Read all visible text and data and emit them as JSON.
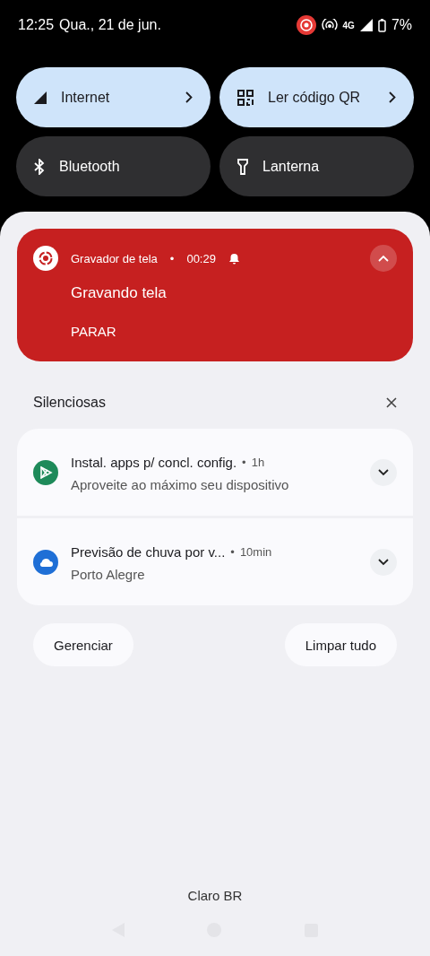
{
  "status_bar": {
    "time": "12:25",
    "date": "Qua., 21 de jun.",
    "network": "4G",
    "battery": "7%"
  },
  "tiles": [
    {
      "label": "Internet",
      "on": true,
      "kind": "signal",
      "chevron": true
    },
    {
      "label": "Ler código QR",
      "on": true,
      "kind": "qr",
      "chevron": true
    },
    {
      "label": "Bluetooth",
      "on": false,
      "kind": "bluetooth",
      "chevron": false
    },
    {
      "label": "Lanterna",
      "on": false,
      "kind": "flashlight",
      "chevron": false
    }
  ],
  "ongoing": {
    "app": "Gravador de tela",
    "separator": "•",
    "time": "00:29",
    "title": "Gravando tela",
    "action": "PARAR",
    "expanded": true
  },
  "silent": {
    "header": "Silenciosas",
    "notifications": [
      {
        "kind": "play",
        "title": "Instal. apps p/ concl. config.",
        "separator": "•",
        "time": "1h",
        "text": "Aproveite ao máximo seu dispositivo",
        "color": "#1e8a5a"
      },
      {
        "kind": "cloud",
        "title": "Previsão de chuva por v...",
        "separator": "•",
        "time": "10min",
        "text": "Porto Alegre",
        "color": "#1f6fd6"
      }
    ]
  },
  "buttons": [
    "Gerenciar",
    "Limpar tudo"
  ],
  "carrier": "Claro BR"
}
